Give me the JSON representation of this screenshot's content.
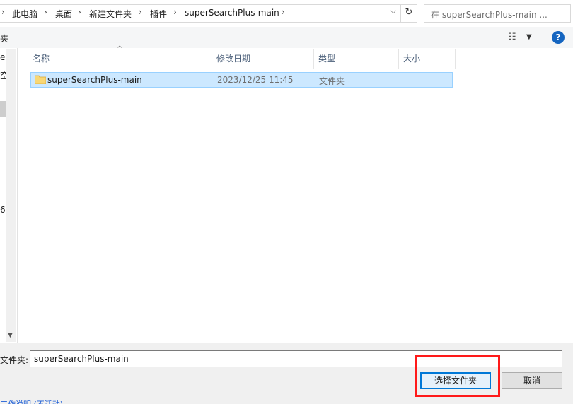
{
  "breadcrumb": [
    "此电脑",
    "桌面",
    "新建文件夹",
    "插件",
    "superSearchPlus-main"
  ],
  "breadcrumb_sep": "›",
  "address_dropdown": "⌵",
  "refresh_glyph": "↻",
  "search": {
    "placeholder": "在 superSearchPlus-main ..."
  },
  "toolbar": {
    "new_folder": "夹",
    "view_glyph": "☷",
    "view_drop": "▼",
    "help": "?"
  },
  "nav": {
    "fragments": [
      "er",
      "空",
      "-",
      "6"
    ]
  },
  "columns": {
    "name": "名称",
    "modified": "修改日期",
    "type": "类型",
    "size": "大小"
  },
  "sort_glyph": "^",
  "files": [
    {
      "name": "superSearchPlus-main",
      "modified": "2023/12/25 11:45",
      "type": "文件夹",
      "size": ""
    }
  ],
  "bottom": {
    "folder_label": "文件夹:",
    "folder_value": "superSearchPlus-main",
    "select_button": "选择文件夹",
    "cancel_button": "取消"
  },
  "peek_text": "工作说明 (不活动)",
  "colors": {
    "accent": "#0078d7",
    "selection": "#cce8ff",
    "highlight": "#ff1a1a"
  }
}
